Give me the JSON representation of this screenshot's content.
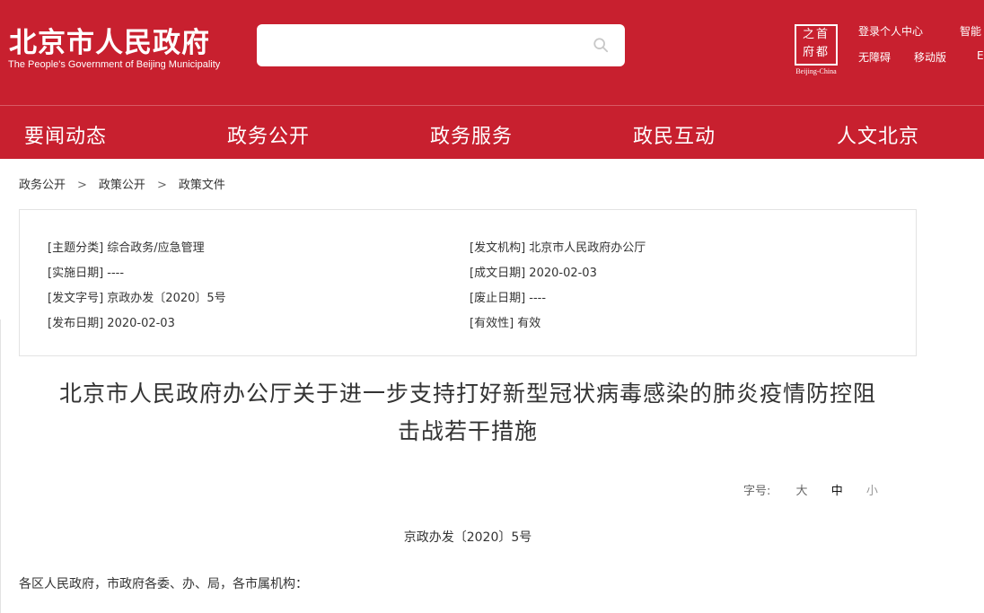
{
  "header": {
    "logo_cn": "北京市人民政府",
    "logo_en": "The People's Government of Beijing Municipality",
    "search": {
      "placeholder": ""
    },
    "emblem": {
      "chars": "之首 府都",
      "caption": "Beijing-China"
    },
    "links": {
      "login": "登录个人中心",
      "smart": "智能",
      "accessible": "无障碍",
      "mobile": "移动版",
      "english": "E"
    }
  },
  "nav": {
    "items": [
      "要闻动态",
      "政务公开",
      "政务服务",
      "政民互动",
      "人文北京"
    ]
  },
  "breadcrumb": [
    "政务公开",
    "政策公开",
    "政策文件"
  ],
  "breadcrumb_sep": ">",
  "meta": {
    "left": [
      {
        "label": "[主题分类]",
        "value": "综合政务/应急管理"
      },
      {
        "label": "[实施日期]",
        "value": "----"
      },
      {
        "label": "[发文字号]",
        "value": "京政办发〔2020〕5号"
      },
      {
        "label": "[发布日期]",
        "value": "2020-02-03"
      }
    ],
    "right": [
      {
        "label": "[发文机构]",
        "value": "北京市人民政府办公厅"
      },
      {
        "label": "[成文日期]",
        "value": "2020-02-03"
      },
      {
        "label": "[废止日期]",
        "value": "----"
      },
      {
        "label": "[有效性]",
        "value": "有效"
      }
    ]
  },
  "document": {
    "title_line1": "北京市人民政府办公厅关于进一步支持打好新型冠状病毒感染的肺炎疫情防控阻",
    "title_line2": "击战若干措施",
    "font_size": {
      "label": "字号:",
      "options": [
        "大",
        "中",
        "小"
      ],
      "selected": "中"
    },
    "number": "京政办发〔2020〕5号",
    "recipients": "各区人民政府，市政府各委、办、局，各市属机构："
  },
  "colors": {
    "brand_red": "#c8202f",
    "text": "#333333",
    "border": "#e3e3e3"
  }
}
